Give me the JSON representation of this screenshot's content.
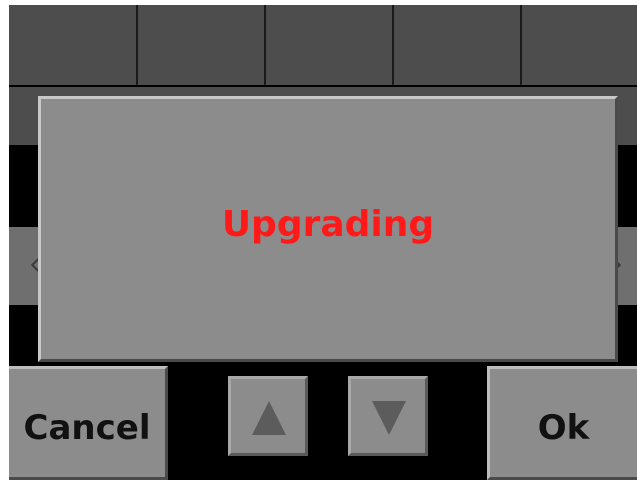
{
  "dialog": {
    "message": "Upgrading",
    "message_color": "#ff1a1a"
  },
  "buttons": {
    "cancel_label": "Cancel",
    "ok_label": "Ok",
    "up_icon": "arrow-up-icon",
    "down_icon": "arrow-down-icon"
  },
  "colors": {
    "screen_background": "#000000",
    "button_face": "#8c8c8c",
    "grid_cell": "#4d4d4d"
  }
}
